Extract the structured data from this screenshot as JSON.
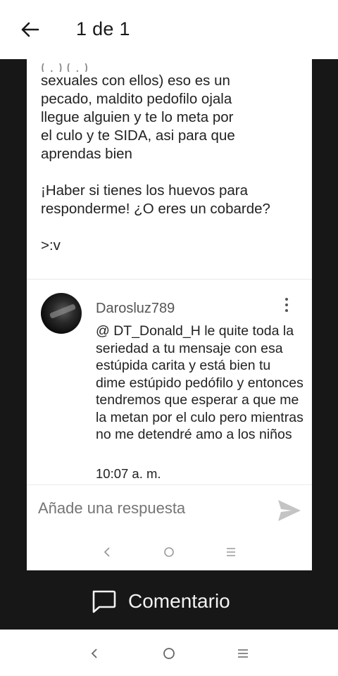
{
  "header": {
    "title": "1 de 1",
    "back_icon": "arrow-left-icon"
  },
  "post": {
    "cut_line": "(  .  ) (  .  )",
    "paragraphs": [
      [
        "sexuales con ellos) eso es un",
        "pecado, maldito pedofilo ojala",
        "llegue alguien y te lo meta por",
        "el culo y te SIDA, asi para que",
        "aprendas bien"
      ],
      [
        "¡Haber si tienes los huevos para",
        "responderme! ¿O eres un cobarde?"
      ],
      [
        ">:v"
      ]
    ]
  },
  "reply": {
    "username": "Darosluz789",
    "text": "@ DT_Donald_H  le quite toda la seriedad a tu mensaje con esa estúpida carita y está bien tu dime estúpido pedófilo y entonces tendremos que esperar a que me la metan por el culo pero mientras no me detendré amo a los niños",
    "time": "10:07 a. m.",
    "menu_icon": "kebab-menu-icon"
  },
  "reply_bar": {
    "placeholder": "Añade una respuesta",
    "send_icon": "send-icon"
  },
  "inner_nav": {
    "icons": [
      "chevron-left-icon",
      "circle-home-icon",
      "menu-lines-icon"
    ]
  },
  "comment_button": {
    "label": "Comentario",
    "icon": "comment-bubble-icon"
  },
  "system_nav": {
    "icons": [
      "back-chevron-icon",
      "home-circle-icon",
      "recents-lines-icon"
    ]
  },
  "colors": {
    "viewer_bg": "#171717",
    "text": "#222222",
    "muted": "#555555",
    "send_disabled": "#c4c4c4"
  }
}
